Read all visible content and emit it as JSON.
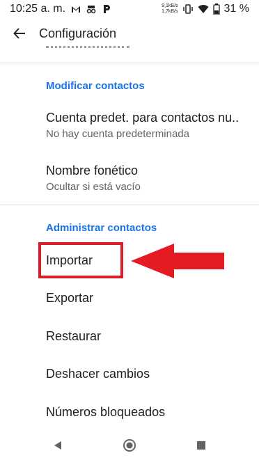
{
  "status_bar": {
    "time": "10:25 a. m.",
    "net_speed_down": "9,1kB/s",
    "net_speed_up": "1,7kB/s",
    "battery": "31 %"
  },
  "app_bar": {
    "title": "Configuración"
  },
  "sections": {
    "modify": {
      "header": "Modificar contactos",
      "items": [
        {
          "title": "Cuenta predet. para contactos nu..",
          "subtitle": "No hay cuenta predeterminada"
        },
        {
          "title": "Nombre fonético",
          "subtitle": "Ocultar si está vacío"
        }
      ]
    },
    "manage": {
      "header": "Administrar contactos",
      "items": [
        {
          "title": "Importar"
        },
        {
          "title": "Exportar"
        },
        {
          "title": "Restaurar"
        },
        {
          "title": "Deshacer cambios"
        },
        {
          "title": "Números bloqueados"
        }
      ]
    }
  },
  "colors": {
    "accent": "#1a73e8",
    "highlight": "#d71e2a"
  },
  "icons": {
    "back": "arrow-left-icon",
    "nav_back": "triangle-back-icon",
    "nav_home": "circle-home-icon",
    "nav_recents": "square-recents-icon"
  }
}
